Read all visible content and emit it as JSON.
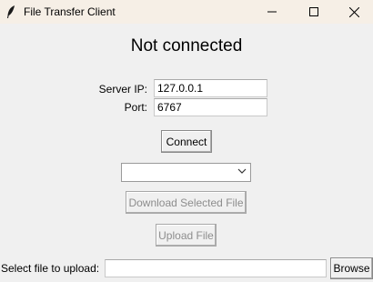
{
  "window": {
    "title": "File Transfer Client"
  },
  "status": {
    "text": "Not connected"
  },
  "server": {
    "ip_label": "Server IP:",
    "ip_value": "127.0.0.1",
    "port_label": "Port:",
    "port_value": "6767"
  },
  "buttons": {
    "connect": "Connect",
    "download": "Download Selected File",
    "upload": "Upload File",
    "browse": "Browse"
  },
  "file_select": {
    "selected": ""
  },
  "upload_row": {
    "label": "Select file to upload:",
    "path_value": ""
  },
  "icons": {
    "app": "feather-icon",
    "minimize": "minimize-icon",
    "maximize": "maximize-icon",
    "close": "close-icon",
    "dropdown": "chevron-down-icon"
  }
}
